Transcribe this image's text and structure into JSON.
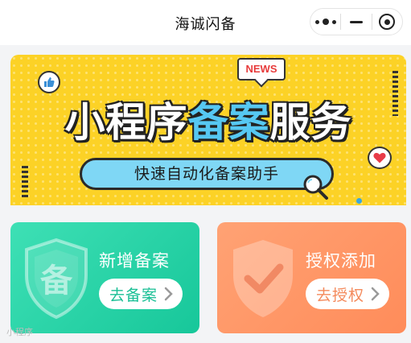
{
  "header": {
    "title": "海诚闪备",
    "capsule": {
      "more_icon": "more-dots-icon",
      "minimize_icon": "minus-icon",
      "close_icon": "target-circle-icon"
    }
  },
  "banner": {
    "news_tag": "NEWS",
    "title_part1": "小程序",
    "title_part2": "备案",
    "title_part3": "服务",
    "subtitle": "快速自动化备案助手",
    "colors": {
      "background": "#fcd226",
      "accent_blue": "#56c8f2",
      "pill": "#7fd7f5"
    }
  },
  "cards": [
    {
      "title": "新增备案",
      "button_label": "去备案",
      "emblem_text": "备",
      "color": "#1fd0a3",
      "icon": "shield-icon"
    },
    {
      "title": "授权添加",
      "button_label": "去授权",
      "color": "#ff955f",
      "icon": "shield-check-icon"
    }
  ],
  "footer": {
    "watermark": "小程序"
  }
}
